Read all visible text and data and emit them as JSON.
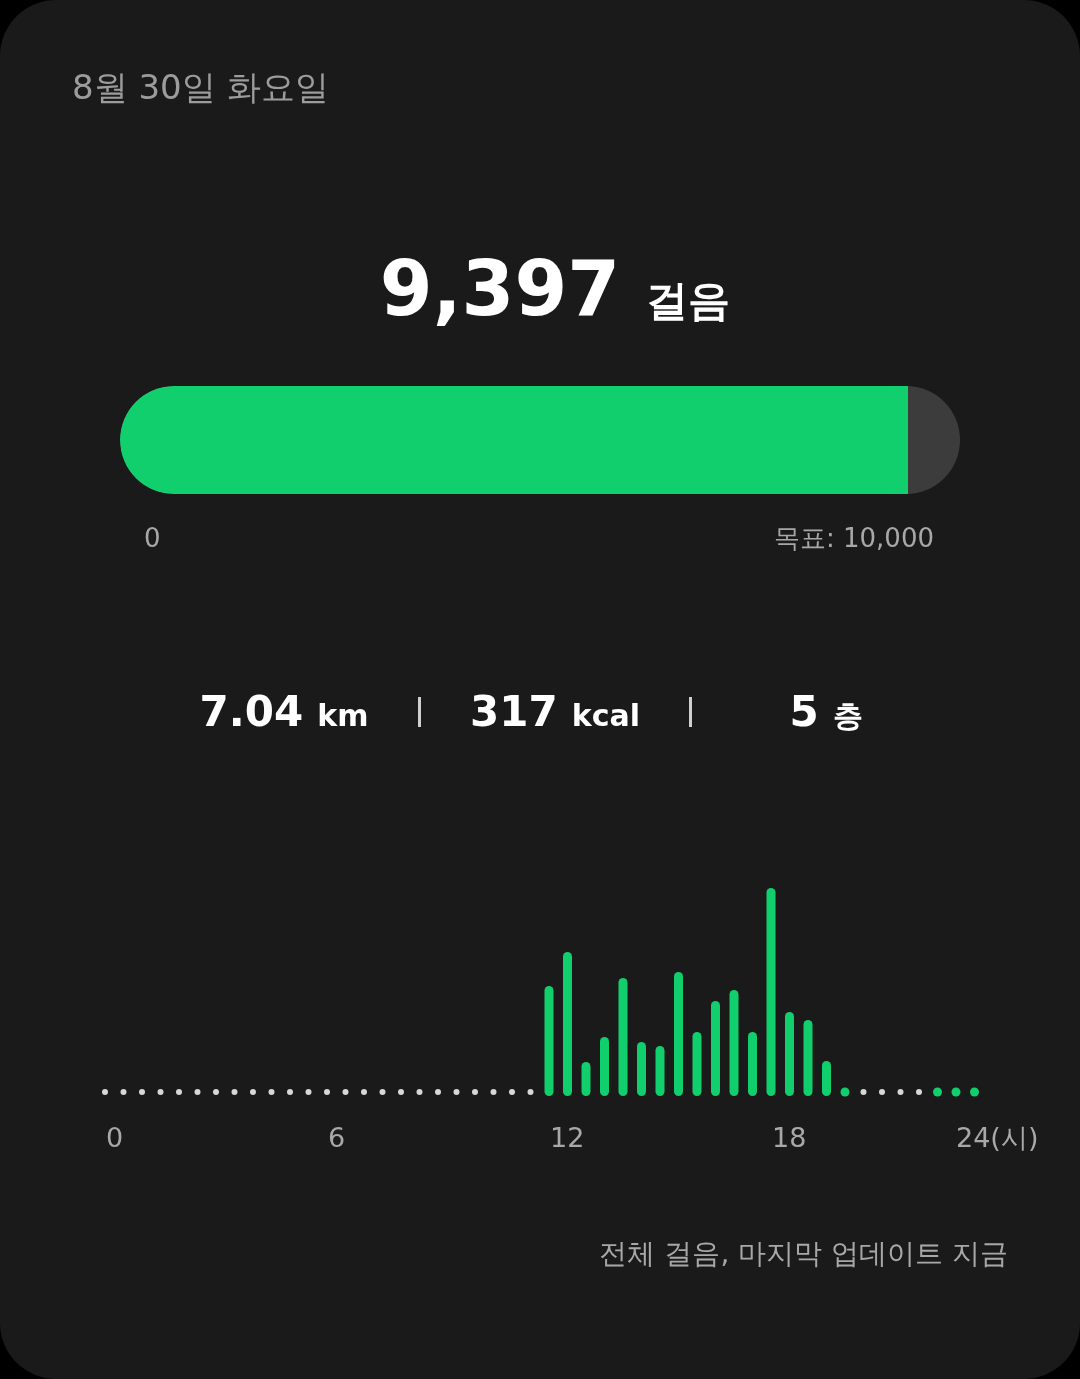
{
  "date": "8월 30일 화요일",
  "steps": {
    "value": "9,397",
    "unit": "걸음"
  },
  "goal_bar": {
    "level": 0.938,
    "start_label": "0",
    "goal_label": "목표: 10,000"
  },
  "stats": [
    {
      "value": "7.04",
      "unit": "km"
    },
    {
      "value": "317",
      "unit": "kcal"
    },
    {
      "value": "5",
      "unit": "층"
    }
  ],
  "hourly_chart": {
    "kind": "picture",
    "axis_labels": [
      "0",
      "6",
      "12",
      "18",
      "24(시)"
    ]
  },
  "footer": "전체 걸음, 마지막 업데이트 지금"
}
